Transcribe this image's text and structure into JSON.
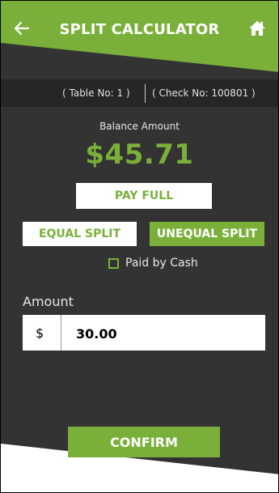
{
  "header": {
    "title": "SPLIT CALCULATOR",
    "back_icon": "arrow-left-icon",
    "home_icon": "home-icon"
  },
  "info": {
    "table": "( Table No: 1 )",
    "check": "( Check No: 100801 )"
  },
  "balance": {
    "label": "Balance Amount",
    "amount": "$45.71"
  },
  "buttons": {
    "pay_full": "PAY FULL",
    "equal_split": "EQUAL SPLIT",
    "unequal_split": "UNEQUAL SPLIT",
    "confirm": "CONFIRM"
  },
  "paid_by_cash": {
    "label": "Paid by Cash",
    "checked": false
  },
  "amount": {
    "label": "Amount",
    "currency": "$",
    "value": "30.00"
  },
  "colors": {
    "accent": "#7ab03a",
    "background": "#333333",
    "info_bar": "#262626"
  }
}
